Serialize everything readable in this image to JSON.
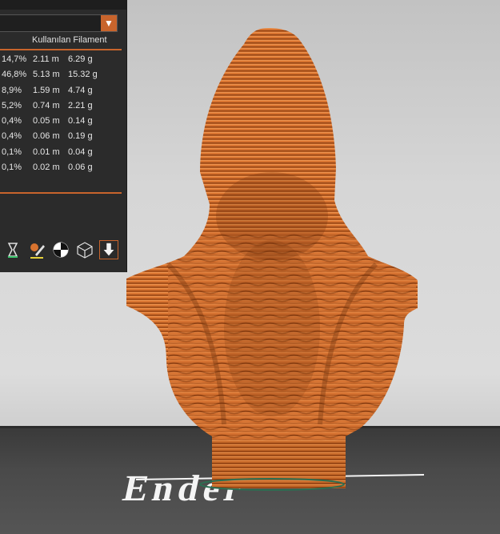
{
  "panel": {
    "column_header": "Kullanılan Filament",
    "dropdown_arrow": "▼",
    "rows": [
      {
        "percent": "14,7%",
        "length": "2.11 m",
        "weight": "6.29 g"
      },
      {
        "percent": "46,8%",
        "length": "5.13 m",
        "weight": "15.32 g"
      },
      {
        "percent": "8,9%",
        "length": "1.59 m",
        "weight": "4.74 g"
      },
      {
        "percent": "5,2%",
        "length": "0.74 m",
        "weight": "2.21 g"
      },
      {
        "percent": "0,4%",
        "length": "0.05 m",
        "weight": "0.14 g"
      },
      {
        "percent": "0,4%",
        "length": "0.06 m",
        "weight": "0.19 g"
      },
      {
        "percent": "0,1%",
        "length": "0.01 m",
        "weight": "0.04 g"
      },
      {
        "percent": "0,1%",
        "length": "0.02 m",
        "weight": "0.06 g"
      }
    ],
    "icons": [
      "hourglass-icon",
      "paint-pen-icon",
      "checker-icon",
      "wireframe-cube-icon",
      "export-down-icon"
    ]
  },
  "bed": {
    "logo_text": "Ender"
  },
  "colors": {
    "accent": "#c8642c",
    "model": "#d8732f",
    "panel_bg": "#2b2b2b"
  }
}
